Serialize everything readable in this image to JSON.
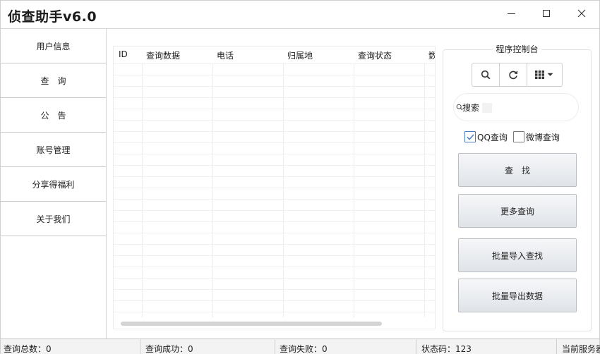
{
  "window": {
    "title": "侦查助手v6.0"
  },
  "sidebar": {
    "items": [
      {
        "label": "用户信息"
      },
      {
        "label": "查　询"
      },
      {
        "label": "公　告"
      },
      {
        "label": "账号管理"
      },
      {
        "label": "分享得福利"
      },
      {
        "label": "关于我们"
      }
    ]
  },
  "table": {
    "columns": [
      "ID",
      "查询数据",
      "电话",
      "归属地",
      "查询状态",
      "数"
    ],
    "rows": []
  },
  "panel": {
    "title": "程序控制台",
    "toolbar": {
      "icons": [
        "search-icon",
        "refresh-icon",
        "grid-icon",
        "caret-down-icon"
      ]
    },
    "search": {
      "value": "",
      "placeholder": "搜索"
    },
    "checkboxes": [
      {
        "label": "QQ查询",
        "checked": true
      },
      {
        "label": "微博查询",
        "checked": false
      }
    ],
    "buttons": {
      "find": "查　找",
      "more": "更多查询",
      "batch_import": "批量导入查找",
      "batch_export": "批量导出数据"
    }
  },
  "status": {
    "total": "查询总数：0",
    "success": "查询成功：0",
    "fail": "查询失败：0",
    "code": "状态码：123",
    "server": "当前服务器"
  },
  "colors": {
    "accent": "#4a7bbf",
    "button_top": "#f6f7f9",
    "button_bottom": "#dfe3e8"
  }
}
